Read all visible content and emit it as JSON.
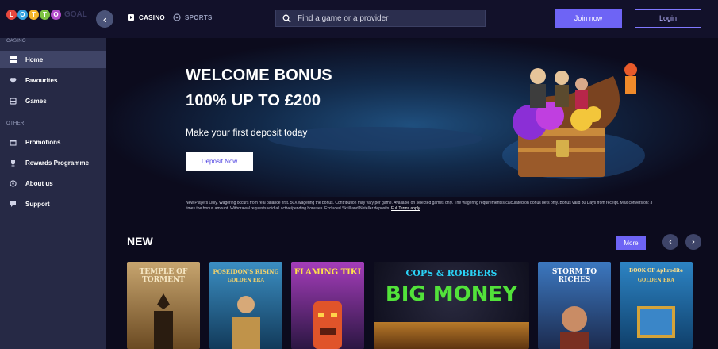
{
  "header": {
    "logo_letters": [
      "L",
      "O",
      "T",
      "T",
      "O"
    ],
    "logo_tail": "GOAL",
    "tabs": [
      {
        "label": "CASINO",
        "active": true
      },
      {
        "label": "SPORTS",
        "active": false
      }
    ],
    "search_placeholder": "Find a game or a provider",
    "join_label": "Join now",
    "login_label": "Login"
  },
  "sidebar": {
    "casino_section": "CASINO",
    "other_section": "OTHER",
    "items": [
      {
        "label": "Home",
        "icon": "grid-icon",
        "active": true
      },
      {
        "label": "Favourites",
        "icon": "heart-icon"
      },
      {
        "label": "Games",
        "icon": "games-icon"
      },
      {
        "label": "Promotions",
        "icon": "gift-icon"
      },
      {
        "label": "Rewards Programme",
        "icon": "trophy-icon"
      },
      {
        "label": "About us",
        "icon": "info-icon"
      },
      {
        "label": "Support",
        "icon": "chat-icon"
      }
    ]
  },
  "hero": {
    "title_line1": "WELCOME BONUS",
    "title_line2": "100% UP TO £200",
    "subtitle": "Make your first deposit today",
    "cta": "Deposit Now",
    "terms": "New Players Only. Wagering occurs from real balance first. 50X wagering the bonus. Contribution may vary per game. Available on selected games only. The wagering requirement is calculated on bonus bets only. Bonus valid 30 Days from receipt. Max conversion: 3 times the bonus amount. Withdrawal requests void all active/pending bonuses. Excluded Skrill and Neteller deposits.",
    "terms_link": "Full Terms apply"
  },
  "new_section": {
    "title": "NEW",
    "more_label": "More",
    "prev": "‹",
    "next": "›",
    "games": [
      {
        "title": "TEMPLE OF TORMENT",
        "sub": "",
        "color": "#8b6a3d"
      },
      {
        "title": "POSEIDON'S RISING",
        "sub": "GOLDEN ERA",
        "color": "#2b6f96"
      },
      {
        "title": "FLAMING TIKI",
        "sub": "",
        "color": "#7b2e8f"
      },
      {
        "title": "COPS & ROBBERS",
        "sub": "BIG MONEY",
        "color": "#1a1a2e"
      },
      {
        "title": "STORM TO RICHES",
        "sub": "",
        "color": "#2f5e9e"
      },
      {
        "title": "BOOK OF Aphrodite",
        "sub": "GOLDEN ERA",
        "color": "#2d84c4"
      }
    ]
  }
}
